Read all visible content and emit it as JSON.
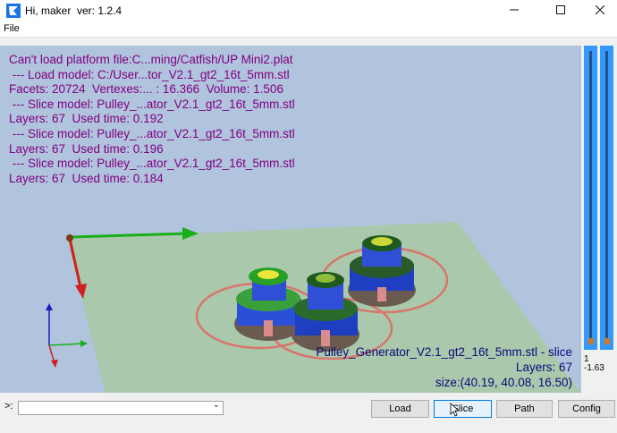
{
  "window": {
    "title": "Hi, maker  ver: 1.2.4",
    "min_icon": "minimize-icon",
    "max_icon": "maximize-icon",
    "close_icon": "close-icon"
  },
  "menu": {
    "file": "File"
  },
  "log": [
    "Can't load platform file:C...ming/Catfish/UP Mini2.plat",
    " --- Load model: C:/User...tor_V2.1_gt2_16t_5mm.stl",
    "Facets: 20724  Vertexes:... : 16.366  Volume: 1.506",
    " --- Slice model: Pulley_...ator_V2.1_gt2_16t_5mm.stl",
    "Layers: 67  Used time: 0.192",
    " --- Slice model: Pulley_...ator_V2.1_gt2_16t_5mm.stl",
    "Layers: 67  Used time: 0.196",
    " --- Slice model: Pulley_...ator_V2.1_gt2_16t_5mm.stl",
    "Layers: 67  Used time: 0.184"
  ],
  "model_info": {
    "name": "Pulley_Generator_V2.1_gt2_16t_5mm.stl - slice",
    "layers": "Layers: 67",
    "size": "size:(40.19, 40.08, 16.50)"
  },
  "layer_slider": {
    "top_value": "1",
    "bottom_value": "-1.63"
  },
  "command": {
    "prompt": ">:",
    "value": ""
  },
  "buttons": {
    "load": "Load",
    "slice": "Slice",
    "path": "Path",
    "config": "Config"
  },
  "colors": {
    "viewport_bg": "#b0c4de",
    "log_text": "#800080",
    "info_text": "#0a0a7a",
    "slider": "#3399ff",
    "platform": "#a9c8a9"
  }
}
